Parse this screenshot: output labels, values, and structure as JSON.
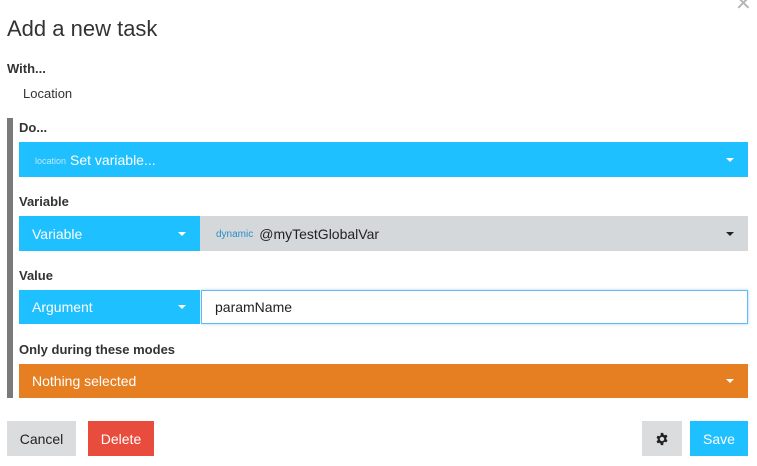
{
  "dialog": {
    "title": "Add a new task",
    "close_icon": "close-icon"
  },
  "with": {
    "label": "With...",
    "value": "Location"
  },
  "do": {
    "label": "Do...",
    "prefix": "location",
    "value": "Set variable..."
  },
  "variable": {
    "label": "Variable",
    "type_value": "Variable",
    "prefix": "dynamic",
    "value": "@myTestGlobalVar"
  },
  "value_field": {
    "label": "Value",
    "type_value": "Argument",
    "input_value": "paramName"
  },
  "modes": {
    "label": "Only during these modes",
    "value": "Nothing selected"
  },
  "buttons": {
    "cancel": "Cancel",
    "delete": "Delete",
    "settings_icon": "gear-icon",
    "save": "Save"
  },
  "colors": {
    "accent_blue": "#1ec0ff",
    "danger_red": "#e74c3c",
    "warning_orange": "#e67e22",
    "neutral_grey": "#d4d8db"
  }
}
